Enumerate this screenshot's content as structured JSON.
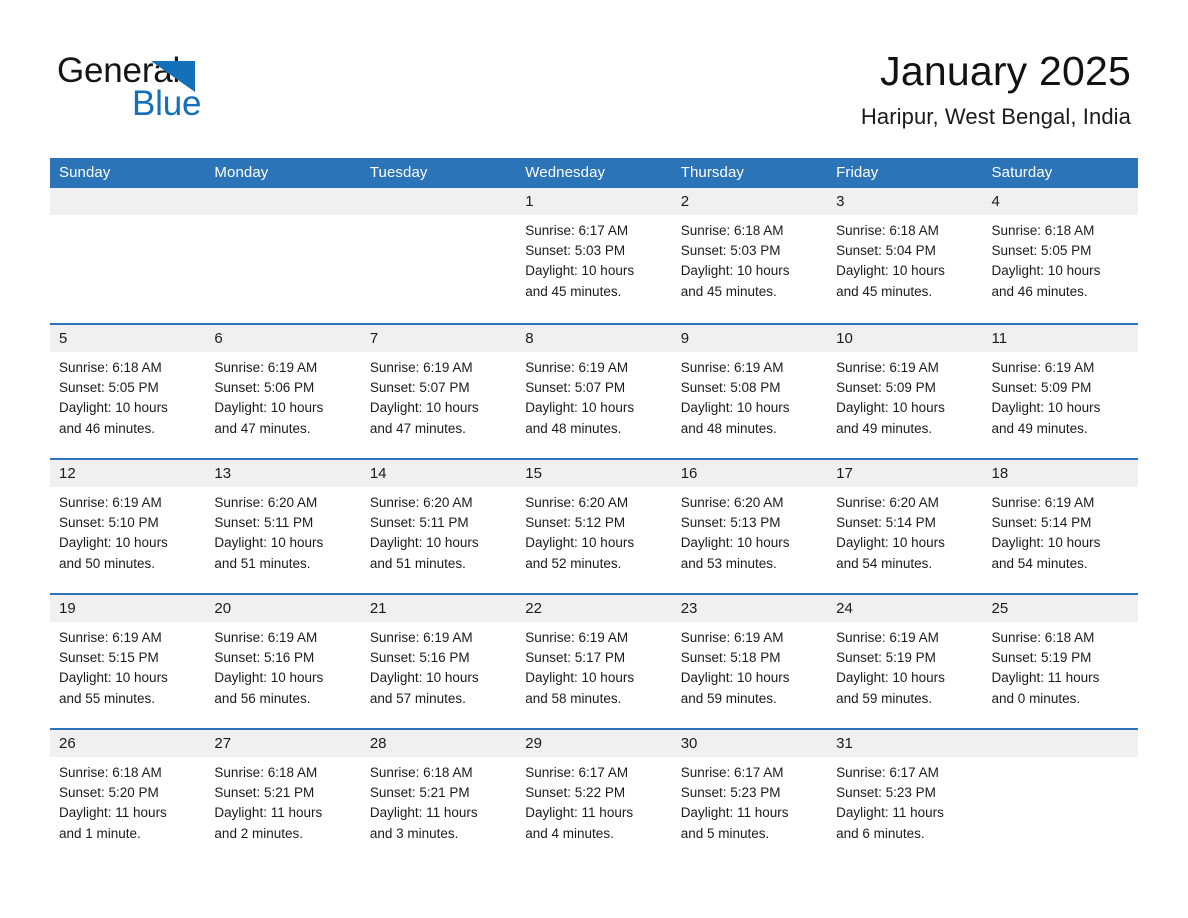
{
  "brand": {
    "name_part1": "General",
    "name_part2": "Blue",
    "accent_color": "#1470b8"
  },
  "header": {
    "title": "January 2025",
    "location": "Haripur, West Bengal, India"
  },
  "theme": {
    "header_blue": "#2b74b8",
    "day_band_gray": "#f0f0f0",
    "text_color": "#1b1b1b"
  },
  "weekdays": [
    "Sunday",
    "Monday",
    "Tuesday",
    "Wednesday",
    "Thursday",
    "Friday",
    "Saturday"
  ],
  "weeks": [
    [
      {
        "day": "",
        "lines": []
      },
      {
        "day": "",
        "lines": []
      },
      {
        "day": "",
        "lines": []
      },
      {
        "day": "1",
        "lines": [
          "Sunrise: 6:17 AM",
          "Sunset: 5:03 PM",
          "Daylight: 10 hours",
          "and 45 minutes."
        ]
      },
      {
        "day": "2",
        "lines": [
          "Sunrise: 6:18 AM",
          "Sunset: 5:03 PM",
          "Daylight: 10 hours",
          "and 45 minutes."
        ]
      },
      {
        "day": "3",
        "lines": [
          "Sunrise: 6:18 AM",
          "Sunset: 5:04 PM",
          "Daylight: 10 hours",
          "and 45 minutes."
        ]
      },
      {
        "day": "4",
        "lines": [
          "Sunrise: 6:18 AM",
          "Sunset: 5:05 PM",
          "Daylight: 10 hours",
          "and 46 minutes."
        ]
      }
    ],
    [
      {
        "day": "5",
        "lines": [
          "Sunrise: 6:18 AM",
          "Sunset: 5:05 PM",
          "Daylight: 10 hours",
          "and 46 minutes."
        ]
      },
      {
        "day": "6",
        "lines": [
          "Sunrise: 6:19 AM",
          "Sunset: 5:06 PM",
          "Daylight: 10 hours",
          "and 47 minutes."
        ]
      },
      {
        "day": "7",
        "lines": [
          "Sunrise: 6:19 AM",
          "Sunset: 5:07 PM",
          "Daylight: 10 hours",
          "and 47 minutes."
        ]
      },
      {
        "day": "8",
        "lines": [
          "Sunrise: 6:19 AM",
          "Sunset: 5:07 PM",
          "Daylight: 10 hours",
          "and 48 minutes."
        ]
      },
      {
        "day": "9",
        "lines": [
          "Sunrise: 6:19 AM",
          "Sunset: 5:08 PM",
          "Daylight: 10 hours",
          "and 48 minutes."
        ]
      },
      {
        "day": "10",
        "lines": [
          "Sunrise: 6:19 AM",
          "Sunset: 5:09 PM",
          "Daylight: 10 hours",
          "and 49 minutes."
        ]
      },
      {
        "day": "11",
        "lines": [
          "Sunrise: 6:19 AM",
          "Sunset: 5:09 PM",
          "Daylight: 10 hours",
          "and 49 minutes."
        ]
      }
    ],
    [
      {
        "day": "12",
        "lines": [
          "Sunrise: 6:19 AM",
          "Sunset: 5:10 PM",
          "Daylight: 10 hours",
          "and 50 minutes."
        ]
      },
      {
        "day": "13",
        "lines": [
          "Sunrise: 6:20 AM",
          "Sunset: 5:11 PM",
          "Daylight: 10 hours",
          "and 51 minutes."
        ]
      },
      {
        "day": "14",
        "lines": [
          "Sunrise: 6:20 AM",
          "Sunset: 5:11 PM",
          "Daylight: 10 hours",
          "and 51 minutes."
        ]
      },
      {
        "day": "15",
        "lines": [
          "Sunrise: 6:20 AM",
          "Sunset: 5:12 PM",
          "Daylight: 10 hours",
          "and 52 minutes."
        ]
      },
      {
        "day": "16",
        "lines": [
          "Sunrise: 6:20 AM",
          "Sunset: 5:13 PM",
          "Daylight: 10 hours",
          "and 53 minutes."
        ]
      },
      {
        "day": "17",
        "lines": [
          "Sunrise: 6:20 AM",
          "Sunset: 5:14 PM",
          "Daylight: 10 hours",
          "and 54 minutes."
        ]
      },
      {
        "day": "18",
        "lines": [
          "Sunrise: 6:19 AM",
          "Sunset: 5:14 PM",
          "Daylight: 10 hours",
          "and 54 minutes."
        ]
      }
    ],
    [
      {
        "day": "19",
        "lines": [
          "Sunrise: 6:19 AM",
          "Sunset: 5:15 PM",
          "Daylight: 10 hours",
          "and 55 minutes."
        ]
      },
      {
        "day": "20",
        "lines": [
          "Sunrise: 6:19 AM",
          "Sunset: 5:16 PM",
          "Daylight: 10 hours",
          "and 56 minutes."
        ]
      },
      {
        "day": "21",
        "lines": [
          "Sunrise: 6:19 AM",
          "Sunset: 5:16 PM",
          "Daylight: 10 hours",
          "and 57 minutes."
        ]
      },
      {
        "day": "22",
        "lines": [
          "Sunrise: 6:19 AM",
          "Sunset: 5:17 PM",
          "Daylight: 10 hours",
          "and 58 minutes."
        ]
      },
      {
        "day": "23",
        "lines": [
          "Sunrise: 6:19 AM",
          "Sunset: 5:18 PM",
          "Daylight: 10 hours",
          "and 59 minutes."
        ]
      },
      {
        "day": "24",
        "lines": [
          "Sunrise: 6:19 AM",
          "Sunset: 5:19 PM",
          "Daylight: 10 hours",
          "and 59 minutes."
        ]
      },
      {
        "day": "25",
        "lines": [
          "Sunrise: 6:18 AM",
          "Sunset: 5:19 PM",
          "Daylight: 11 hours",
          "and 0 minutes."
        ]
      }
    ],
    [
      {
        "day": "26",
        "lines": [
          "Sunrise: 6:18 AM",
          "Sunset: 5:20 PM",
          "Daylight: 11 hours",
          "and 1 minute."
        ]
      },
      {
        "day": "27",
        "lines": [
          "Sunrise: 6:18 AM",
          "Sunset: 5:21 PM",
          "Daylight: 11 hours",
          "and 2 minutes."
        ]
      },
      {
        "day": "28",
        "lines": [
          "Sunrise: 6:18 AM",
          "Sunset: 5:21 PM",
          "Daylight: 11 hours",
          "and 3 minutes."
        ]
      },
      {
        "day": "29",
        "lines": [
          "Sunrise: 6:17 AM",
          "Sunset: 5:22 PM",
          "Daylight: 11 hours",
          "and 4 minutes."
        ]
      },
      {
        "day": "30",
        "lines": [
          "Sunrise: 6:17 AM",
          "Sunset: 5:23 PM",
          "Daylight: 11 hours",
          "and 5 minutes."
        ]
      },
      {
        "day": "31",
        "lines": [
          "Sunrise: 6:17 AM",
          "Sunset: 5:23 PM",
          "Daylight: 11 hours",
          "and 6 minutes."
        ]
      },
      {
        "day": "",
        "lines": []
      }
    ]
  ]
}
